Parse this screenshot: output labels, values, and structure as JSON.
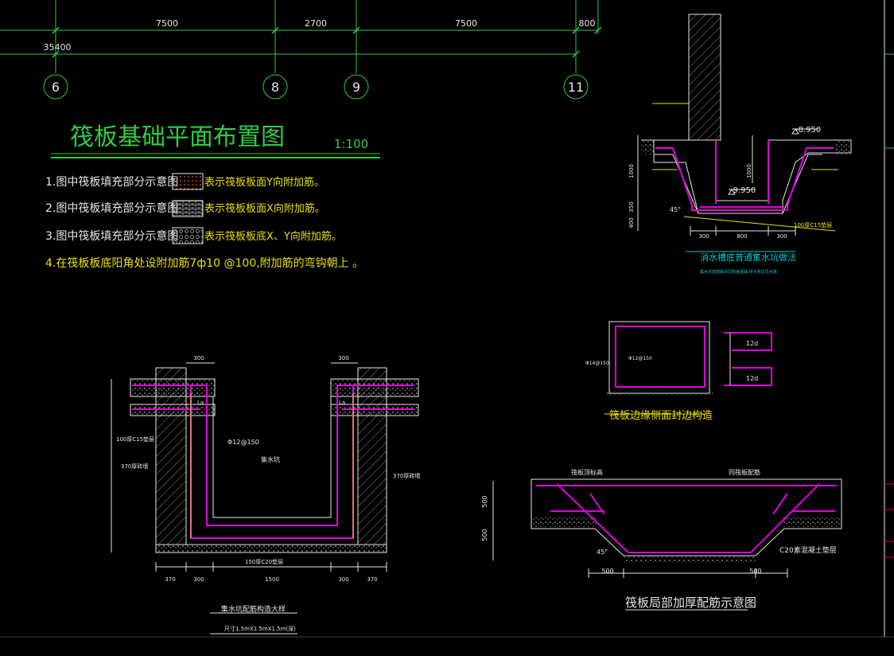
{
  "grid": {
    "dims": [
      "7500",
      "2700",
      "7500",
      "800"
    ],
    "total": "35400",
    "axes": [
      "6",
      "8",
      "9",
      "11"
    ]
  },
  "plan": {
    "title": "筏板基础平面布置图",
    "scale": "1:100"
  },
  "notes": [
    {
      "left": "1.图中筏板填充部分示意图",
      "right": "表示筏板板面Y向附加筋。"
    },
    {
      "left": "2.图中筏板填充部分示意图",
      "right": "表示筏板板面X向附加筋。"
    },
    {
      "left": "3.图中筏板填充部分示意图",
      "right": "表示筏板板底X、Y向附加筋。"
    },
    {
      "left": "4.在筏板板底阳角处设附加筋7ф10 @100,附加筋的弯钩朝上 。",
      "right": ""
    }
  ],
  "pit_top": {
    "level_high": "-8.950",
    "level_low": "-9.950",
    "dims_bottom": [
      "300",
      "800",
      "300"
    ],
    "dims_left": [
      "1000",
      "350",
      "400"
    ],
    "dim_right": "1000",
    "angle": "45°",
    "cushion": "100厚C15垫层",
    "title": "消水槽底普通集水坑做法",
    "subtitle": "集水坑底部做法同筏板基础,排水管详见水施."
  },
  "edge": {
    "title": "筏板边缘侧面封边构造",
    "d1": "12d",
    "d2": "12d",
    "rebar": "Φ12@150",
    "rebar2": "Φ14@150"
  },
  "sump": {
    "title": "集水坑配筋构造大样",
    "subtitle": "尺寸1.5mX1.5mX1.5m(深)",
    "rebar": "Φ12@150",
    "center_label": "集水坑",
    "cushion_left": "100厚C15垫层",
    "wall_left": "370厚砖墙",
    "wall_right": "370厚砖墙",
    "bottom_cushion": "150厚C20垫层",
    "dims_top": [
      "300",
      "300"
    ],
    "dims_bottom": [
      "370",
      "300",
      "1500",
      "300",
      "370"
    ],
    "la": "La"
  },
  "thicken": {
    "title": "筏板局部加厚配筋示意图",
    "top_label": "筏板顶标高",
    "top_rebar": "同筏板配筋",
    "cushion": "C20素混凝土垫层",
    "dims_left": [
      "500",
      "500"
    ],
    "dims_bottom": [
      "500",
      "500"
    ],
    "angle": "45°"
  }
}
